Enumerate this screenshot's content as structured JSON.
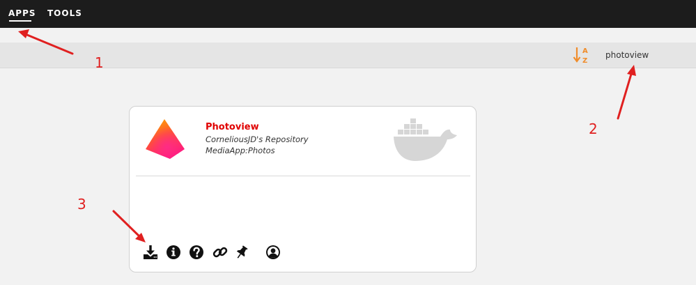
{
  "nav": {
    "tabs": [
      {
        "label": "APPS",
        "active": true
      },
      {
        "label": "TOOLS",
        "active": false
      }
    ]
  },
  "filter": {
    "sort_icon": "sort-alpha-down-icon",
    "search_value": "photoview",
    "accent_color": "#f08c2a"
  },
  "card": {
    "name": "Photoview",
    "repository": "CorneliousJD's Repository",
    "category": "MediaApp:Photos",
    "name_color": "#e00000",
    "actions": [
      {
        "icon": "install-icon"
      },
      {
        "icon": "info-icon"
      },
      {
        "icon": "help-icon"
      },
      {
        "icon": "link-icon"
      },
      {
        "icon": "pin-icon"
      },
      {
        "icon": "user-profile-icon"
      }
    ]
  },
  "annotations": {
    "labels": [
      "1",
      "2",
      "3"
    ],
    "color": "#e02020"
  }
}
